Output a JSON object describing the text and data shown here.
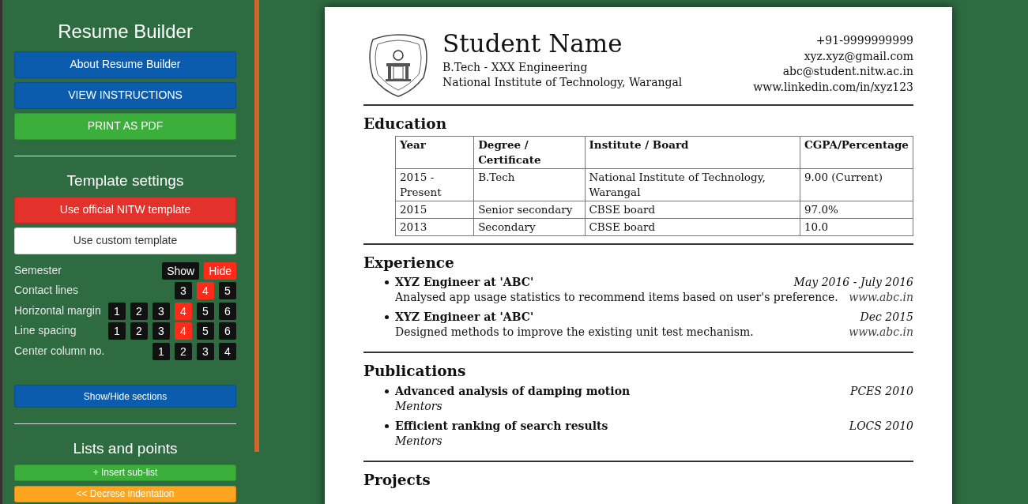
{
  "sidebar": {
    "title": "Resume Builder",
    "top_buttons": [
      {
        "label": "About Resume Builder",
        "kind": "blue"
      },
      {
        "label": "VIEW INSTRUCTIONS",
        "kind": "blue"
      },
      {
        "label": "PRINT AS PDF",
        "kind": "green"
      }
    ],
    "template_settings": {
      "heading": "Template settings",
      "templates": [
        {
          "label": "Use official NITW template",
          "selected": true
        },
        {
          "label": "Use custom template",
          "selected": false
        }
      ],
      "settings": [
        {
          "label": "Semester",
          "options": [
            {
              "label": "Show",
              "selected": false
            },
            {
              "label": "Hide",
              "selected": true
            }
          ]
        },
        {
          "label": "Contact lines",
          "options": [
            {
              "label": "3",
              "selected": false
            },
            {
              "label": "4",
              "selected": true
            },
            {
              "label": "5",
              "selected": false
            }
          ]
        },
        {
          "label": "Horizontal margin",
          "options": [
            {
              "label": "1",
              "selected": false
            },
            {
              "label": "2",
              "selected": false
            },
            {
              "label": "3",
              "selected": false
            },
            {
              "label": "4",
              "selected": true
            },
            {
              "label": "5",
              "selected": false
            },
            {
              "label": "6",
              "selected": false
            }
          ]
        },
        {
          "label": "Line spacing",
          "options": [
            {
              "label": "1",
              "selected": false
            },
            {
              "label": "2",
              "selected": false
            },
            {
              "label": "3",
              "selected": false
            },
            {
              "label": "4",
              "selected": true
            },
            {
              "label": "5",
              "selected": false
            },
            {
              "label": "6",
              "selected": false
            }
          ]
        },
        {
          "label": "Center column no.",
          "options": [
            {
              "label": "1",
              "selected": false
            },
            {
              "label": "2",
              "selected": false
            },
            {
              "label": "3",
              "selected": false
            },
            {
              "label": "4",
              "selected": false
            }
          ]
        }
      ],
      "sections_button": "Show/Hide sections"
    },
    "lists": {
      "heading": "Lists and points",
      "buttons": [
        {
          "label": "+ Insert sub-list",
          "kind": "green"
        },
        {
          "label": "<< Decrese indentation",
          "kind": "orange"
        }
      ]
    }
  },
  "resume": {
    "header": {
      "name": "Student Name",
      "lines": [
        "B.Tech - XXX Engineering",
        "National Institute of Technology, Warangal"
      ],
      "contacts": [
        "+91-9999999999",
        "xyz.xyz@gmail.com",
        "abc@student.nitw.ac.in",
        "www.linkedin.com/in/xyz123"
      ]
    },
    "sections": [
      {
        "title": "Education",
        "kind": "table",
        "columns": [
          "Year",
          "Degree / Certificate",
          "Institute / Board",
          "CGPA/Percentage"
        ],
        "rows": [
          [
            "2015 - Present",
            "B.Tech",
            "National Institute of Technology, Warangal",
            "9.00 (Current)"
          ],
          [
            "2015",
            "Senior secondary",
            "CBSE board",
            "97.0%"
          ],
          [
            "2013",
            "Secondary",
            "CBSE board",
            "10.0"
          ]
        ]
      },
      {
        "title": "Experience",
        "kind": "entries",
        "items": [
          {
            "title": "XYZ Engineer at 'ABC'",
            "date": "May 2016 - July 2016",
            "description": "Analysed app usage statistics to recommend items based on user's preference.",
            "link": "www.abc.in"
          },
          {
            "title": "XYZ Engineer at 'ABC'",
            "date": "Dec 2015",
            "description": "Designed methods to improve the existing unit test mechanism.",
            "link": "www.abc.in"
          }
        ]
      },
      {
        "title": "Publications",
        "kind": "publications",
        "items": [
          {
            "title": "Advanced analysis of damping motion",
            "venue": "PCES 2010",
            "authors": "Mentors"
          },
          {
            "title": "Efficient ranking of search results",
            "venue": "LOCS 2010",
            "authors": "Mentors"
          }
        ]
      },
      {
        "title": "Projects",
        "kind": "heading"
      }
    ]
  }
}
